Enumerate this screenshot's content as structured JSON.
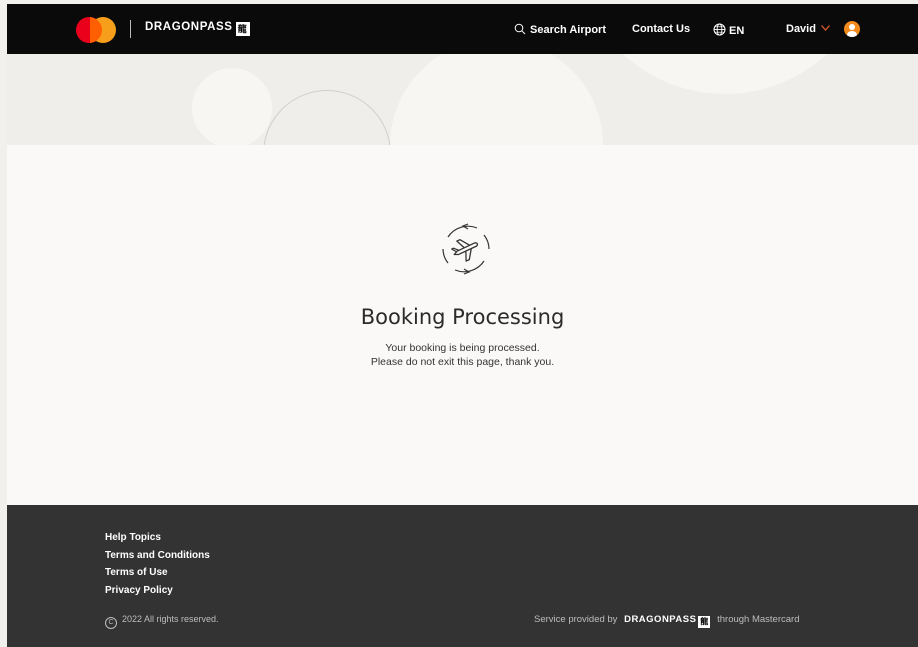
{
  "header": {
    "brand": "DRAGONPASS",
    "brand_mark": "龍",
    "search_label": "Search Airport",
    "contact_label": "Contact Us",
    "language": "EN",
    "user_name": "David",
    "chevron": "⌄"
  },
  "main": {
    "title": "Booking Processing",
    "message_line1": "Your booking is being processed.",
    "message_line2": "Please do not exit this page, thank you."
  },
  "footer": {
    "links": [
      "Help Topics",
      "Terms and Conditions",
      "Terms of Use",
      "Privacy Policy"
    ],
    "copyright": "2022 All rights reserved.",
    "copyright_symbol": "C",
    "service_prefix": "Service provided by",
    "service_brand": "DRAGONPASS",
    "service_mark": "龍",
    "service_suffix": "through Mastercard"
  },
  "icons": {
    "search": "search-icon",
    "globe": "globe-icon",
    "avatar": "user-avatar-icon",
    "status": "plane-refresh-icon"
  },
  "colors": {
    "header_bg": "#0a0a0a",
    "footer_bg": "#333333",
    "accent_orange": "#e0592a",
    "mastercard_red": "#eb001b",
    "mastercard_yellow": "#f79e1b"
  }
}
